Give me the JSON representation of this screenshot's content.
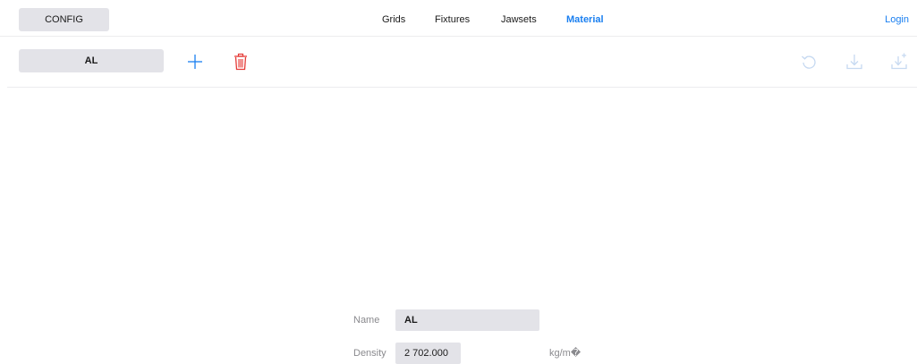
{
  "header": {
    "config_label": "CONFIG",
    "nav": [
      {
        "label": "Grids",
        "active": false
      },
      {
        "label": "Fixtures",
        "active": false
      },
      {
        "label": "Jawsets",
        "active": false
      },
      {
        "label": "Material",
        "active": true
      }
    ],
    "login_label": "Login",
    "accent_color": "#1a7ff0"
  },
  "toolbar": {
    "selected_material": "AL",
    "icons": [
      "plus-icon",
      "trash-icon",
      "undo-icon",
      "download-icon",
      "download-new-icon"
    ],
    "delete_color": "#e53935",
    "disabled_color": "#c6d9f1"
  },
  "form": {
    "name_label": "Name",
    "name_value": "AL",
    "density_label": "Density",
    "density_value": "2 702.000",
    "density_unit": "kg/m�"
  }
}
